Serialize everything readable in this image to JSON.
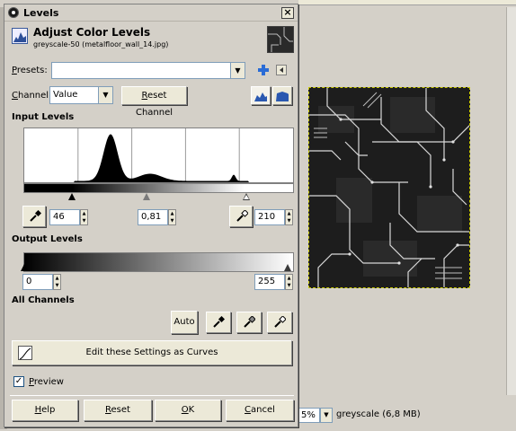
{
  "dialog": {
    "title": "Levels",
    "header_title": "Adjust Color Levels",
    "header_subtitle": "greyscale-50 (metalfloor_wall_14.jpg)",
    "close_glyph": "×"
  },
  "presets": {
    "label": "Presets:",
    "value": "",
    "add_icon": "plus-icon",
    "menu_icon": "menu-arrow-icon"
  },
  "channel": {
    "label": "Channel:",
    "value": "Value",
    "reset_label": "Reset Channel",
    "linear_icon": "linear-histogram-icon",
    "log_icon": "log-histogram-icon"
  },
  "input_levels": {
    "heading": "Input Levels",
    "low": "46",
    "gamma": "0,81",
    "high": "210",
    "low_value": 46,
    "high_value": 210,
    "gamma_value": 0.81,
    "black_picker_icon": "black-eyedropper-icon",
    "white_picker_icon": "white-eyedropper-icon"
  },
  "output_levels": {
    "heading": "Output Levels",
    "low": "0",
    "high": "255"
  },
  "all_channels": {
    "heading": "All Channels",
    "auto_label": "Auto",
    "black_icon": "black-point-eyedropper-icon",
    "gray_icon": "gray-point-eyedropper-icon",
    "white_icon": "white-point-eyedropper-icon"
  },
  "curves_button": {
    "label": "Edit these Settings as Curves",
    "icon": "curves-icon"
  },
  "preview": {
    "label": "Preview",
    "checked": true
  },
  "buttons": {
    "help": "Help",
    "reset": "Reset",
    "ok": "OK",
    "cancel": "Cancel"
  },
  "image_window": {
    "zoom": "5%",
    "status": "greyscale (6,8 MB)"
  },
  "colors": {
    "dialog_bg": "#d4d0c8",
    "accent_blue": "#1c5dc9",
    "histogram_fill": "#000000"
  }
}
